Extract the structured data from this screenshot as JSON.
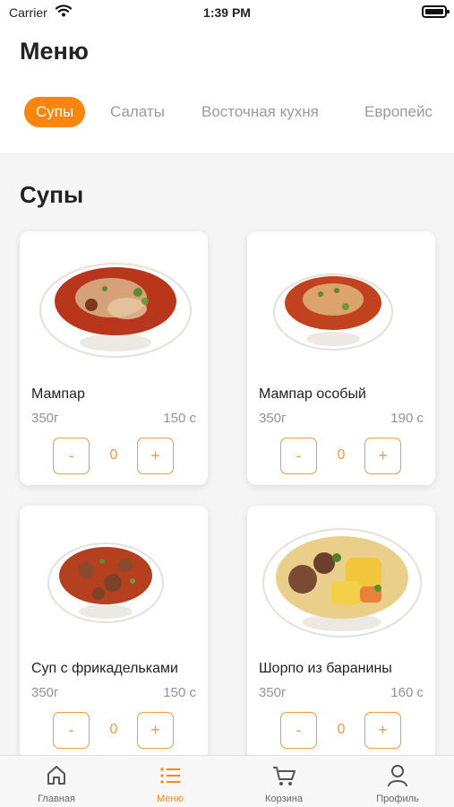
{
  "status_bar": {
    "carrier": "Carrier",
    "time": "1:39 PM"
  },
  "header": {
    "title": "Меню"
  },
  "categories": [
    "Супы",
    "Салаты",
    "Восточная кухня",
    "Европейс"
  ],
  "section": {
    "title": "Супы"
  },
  "items": [
    {
      "name": "Мампар",
      "weight": "350г",
      "price": "150 с",
      "qty": "0",
      "minus": "-",
      "plus": "+"
    },
    {
      "name": "Мампар особый",
      "weight": "350г",
      "price": "190 с",
      "qty": "0",
      "minus": "-",
      "plus": "+"
    },
    {
      "name": "Суп с фрикадельками",
      "weight": "350г",
      "price": "150 с",
      "qty": "0",
      "minus": "-",
      "plus": "+"
    },
    {
      "name": "Шорпо из баранины",
      "weight": "350г",
      "price": "160 с",
      "qty": "0",
      "minus": "-",
      "plus": "+"
    }
  ],
  "bottom_nav": [
    {
      "label": "Главная",
      "icon": "home-icon"
    },
    {
      "label": "Меню",
      "icon": "list-icon"
    },
    {
      "label": "Корзина",
      "icon": "cart-icon"
    },
    {
      "label": "Профиль",
      "icon": "profile-icon"
    }
  ],
  "colors": {
    "accent": "#f7860f",
    "muted": "#8f8fa6"
  }
}
